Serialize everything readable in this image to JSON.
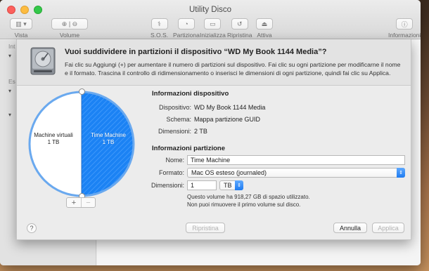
{
  "window": {
    "title": "Utility Disco"
  },
  "toolbar": {
    "items": [
      {
        "label": "Vista"
      },
      {
        "label": "Volume"
      },
      {
        "label": "S.O.S."
      },
      {
        "label": "Partiziona"
      },
      {
        "label": "Inizializza"
      },
      {
        "label": "Ripristina"
      },
      {
        "label": "Attiva"
      },
      {
        "label": "Informazioni"
      }
    ]
  },
  "sidebar": {
    "sections": [
      {
        "label": "Int"
      },
      {
        "label": "Es"
      }
    ]
  },
  "sheet": {
    "title": "Vuoi suddividere in partizioni il dispositivo “WD My Book 1144 Media”?",
    "description": "Fai clic su Aggiungi (+) per aumentare il numero di partizioni sul dispositivo. Fai clic su ogni partizione per modificarne il nome e il formato. Trascina il controllo di ridimensionamento o inserisci le dimensioni di ogni partizione, quindi fai clic su Applica.",
    "pie": {
      "partitions": [
        {
          "name": "Machine virtuali",
          "size": "1 TB",
          "fraction": 0.5,
          "color": "#ffffff"
        },
        {
          "name": "Time Machine",
          "size": "1 TB",
          "fraction": 0.5,
          "color": "#1b82f4",
          "selected": true
        }
      ],
      "add_label": "+",
      "remove_label": "−"
    },
    "device_info": {
      "heading": "Informazioni dispositivo",
      "device_label": "Dispositivo:",
      "device_value": "WD My Book 1144 Media",
      "scheme_label": "Schema:",
      "scheme_value": "Mappa partizione GUID",
      "size_label": "Dimensioni:",
      "size_value": "2 TB"
    },
    "partition_info": {
      "heading": "Informazioni partizione",
      "name_label": "Nome:",
      "name_value": "Time Machine",
      "format_label": "Formato:",
      "format_value": "Mac OS esteso (journaled)",
      "size_label": "Dimensioni:",
      "size_value": "1",
      "unit_value": "TB",
      "note_line1": "Questo volume ha 918,27 GB di spazio utilizzato.",
      "note_line2": "Non puoi rimuovere il primo volume sul disco."
    },
    "buttons": {
      "help": "?",
      "revert": "Ripristina",
      "cancel": "Annulla",
      "apply": "Applica"
    }
  }
}
